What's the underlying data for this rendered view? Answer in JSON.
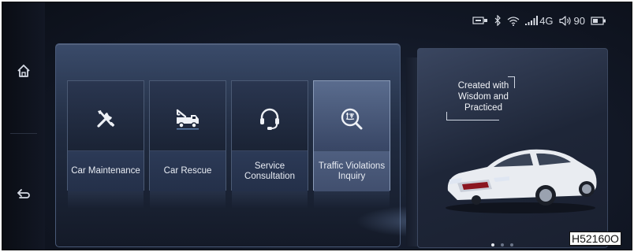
{
  "status_bar": {
    "network_label": "4G",
    "volume_value": "90",
    "icons": [
      "sim-card-icon",
      "bluetooth-icon",
      "wifi-icon",
      "signal-bars-icon",
      "volume-icon",
      "battery-icon"
    ]
  },
  "nav": {
    "items": [
      {
        "name": "home",
        "icon": "home-icon"
      },
      {
        "name": "back",
        "icon": "back-arrow-icon"
      }
    ]
  },
  "services": {
    "tiles": [
      {
        "label": "Car Maintenance",
        "icon": "wrench-screwdriver-icon",
        "selected": false
      },
      {
        "label": "Car Rescue",
        "icon": "tow-truck-icon",
        "selected": false
      },
      {
        "label": "Service Consultation",
        "icon": "headset-icon",
        "selected": false
      },
      {
        "label": "Traffic Violations Inquiry",
        "icon": "violation-search-icon",
        "selected": true
      }
    ]
  },
  "promo": {
    "slogan": "Created with Wisdom and Practiced",
    "pagination": {
      "total": 3,
      "active": 0
    }
  },
  "watermark": "H52160O",
  "colors": {
    "accent": "#8a9bb8",
    "background": "#121826",
    "text": "#e8ecf3"
  }
}
